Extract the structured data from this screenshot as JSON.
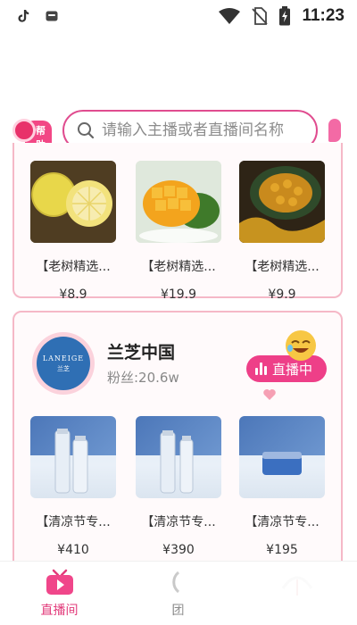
{
  "status_bar": {
    "time": "11:23",
    "left_icons": [
      "tiktok-icon",
      "app-notification-icon"
    ],
    "right_icons": [
      "wifi-icon",
      "no-sim-icon",
      "battery-charging-icon"
    ]
  },
  "header": {
    "help_label": "帮助",
    "search_placeholder": "请输入主播或者直播间名称"
  },
  "card1": {
    "products": [
      {
        "title": "【老树精选...",
        "price": "¥8.9",
        "image": "lemon"
      },
      {
        "title": "【老树精选...",
        "price": "¥19.9",
        "image": "mango"
      },
      {
        "title": "【老树精选...",
        "price": "¥9.9",
        "image": "pumpkin"
      }
    ]
  },
  "card2": {
    "store_name": "兰芝中国",
    "fans": "粉丝:20.6w",
    "live_label": "直播中",
    "avatar_brand": "LANEIGE",
    "avatar_brand_cn": "兰芝",
    "products": [
      {
        "title": "【清凉节专...",
        "price": "¥410",
        "image": "laneige-bottles"
      },
      {
        "title": "【清凉节专...",
        "price": "¥390",
        "image": "laneige-bottles"
      },
      {
        "title": "【清凉节专...",
        "price": "¥195",
        "image": "laneige-jar"
      }
    ]
  },
  "bottom_nav": {
    "items": [
      {
        "label": "直播间",
        "active": true
      },
      {
        "label": "团",
        "active": false
      },
      {
        "label": "",
        "active": false
      }
    ]
  },
  "colors": {
    "accent": "#e23a7a",
    "card_border": "#f5b8c7",
    "search_border": "#e04c8f"
  }
}
